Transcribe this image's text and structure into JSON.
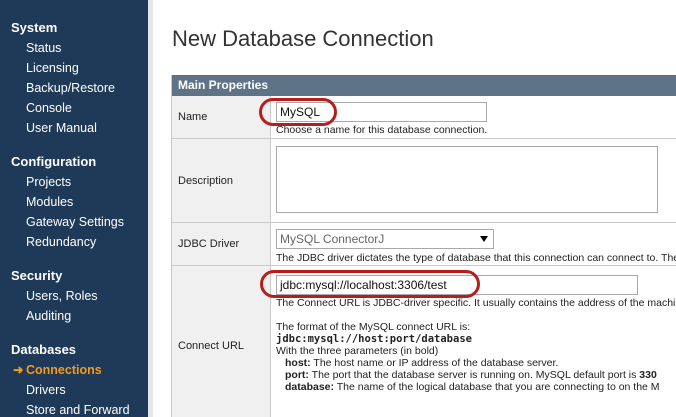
{
  "sidebar": {
    "sections": [
      {
        "title": "System",
        "items": [
          "Status",
          "Licensing",
          "Backup/Restore",
          "Console",
          "User Manual"
        ]
      },
      {
        "title": "Configuration",
        "items": [
          "Projects",
          "Modules",
          "Gateway Settings",
          "Redundancy"
        ]
      },
      {
        "title": "Security",
        "items": [
          "Users, Roles",
          "Auditing"
        ]
      },
      {
        "title": "Databases",
        "items": [
          "Connections",
          "Drivers",
          "Store and Forward"
        ]
      }
    ],
    "active_item": "Connections",
    "active_prefix": "➜"
  },
  "page": {
    "title": "New Database Connection"
  },
  "form": {
    "header": "Main Properties",
    "name": {
      "label": "Name",
      "value": "MySQL",
      "help": "Choose a name for this database connection."
    },
    "description": {
      "label": "Description",
      "value": ""
    },
    "jdbc_driver": {
      "label": "JDBC Driver",
      "value": "MySQL ConnectorJ",
      "help": "The JDBC driver dictates the type of database that this connection can connect to. The"
    },
    "connect_url": {
      "label": "Connect URL",
      "value": "jdbc:mysql://localhost:3306/test",
      "help1": "The Connect URL is JDBC-driver specific. It usually contains the address of the machine",
      "help2": "The format of the MySQL connect URL is:",
      "format": "jdbc:mysql://host:port/database",
      "help3": "With the three parameters (in bold)",
      "params": [
        {
          "name": "host:",
          "desc": " The host name or IP address of the database server."
        },
        {
          "name": "port:",
          "desc": " The port that the database server is running on. MySQL default port is ",
          "extra": "330"
        },
        {
          "name": "database:",
          "desc": " The name of the logical database that you are connecting to on the M"
        }
      ]
    }
  },
  "colors": {
    "sidebar_bg": "#1f3a58",
    "active": "#f39a1e",
    "header_bg": "#5f7386",
    "highlight": "#b81d1d"
  }
}
